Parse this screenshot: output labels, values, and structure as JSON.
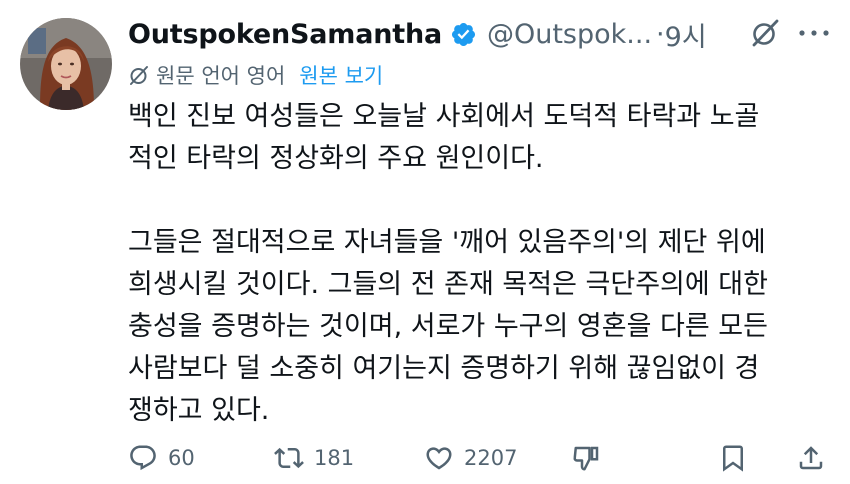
{
  "tweet": {
    "display_name": "OutspokenSamantha",
    "handle": "@Outspok...",
    "separator": "·",
    "time": "9시",
    "translation": {
      "label": "원문 언어 영어",
      "link": "원본 보기"
    },
    "paragraphs": [
      [
        "백인 진보 여성들은 오늘날 사회에서 도덕적 타락과 노골",
        "적인 타락의 정상화의 주요 원인이다."
      ],
      [
        "그들은 절대적으로 자녀들을 '깨어 있음주의'의 제단 위에",
        "희생시킬 것이다. 그들의 전 존재 목적은 극단주의에 대한",
        "충성을 증명하는 것이며, 서로가 누구의 영혼을 다른 모든",
        "사람보다 덜 소중히 여기는지 증명하기 위해 끊임없이 경",
        "쟁하고 있다."
      ]
    ],
    "actions": {
      "replies": "60",
      "retweets": "181",
      "likes": "2207"
    },
    "colors": {
      "verified": "#1d9bf0",
      "link": "#1d9bf0",
      "muted": "#536471",
      "text": "#0f1419"
    },
    "icons": [
      "verified-badge-icon",
      "grok-icon",
      "more-icon",
      "translate-icon",
      "reply-icon",
      "retweet-icon",
      "like-icon",
      "dislike-icon",
      "bookmark-icon",
      "share-icon"
    ]
  }
}
